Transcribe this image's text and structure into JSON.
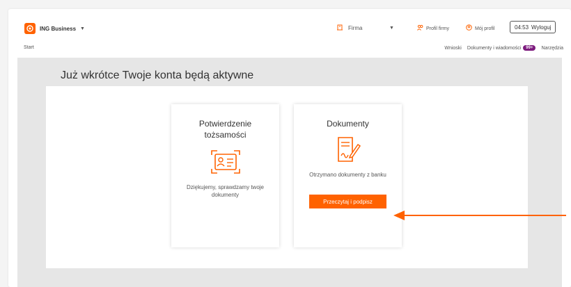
{
  "header": {
    "brand_name": "ING Business",
    "firm_label": "Firma",
    "profile_firm": "Profil firmy",
    "my_profile": "Mój profil",
    "session_time": "04:53",
    "logout": "Wyloguj"
  },
  "nav": {
    "start": "Start",
    "items": [
      {
        "label": "Wnioski"
      },
      {
        "label": "Dokumenty i wiadomości",
        "badge": "99+"
      },
      {
        "label": "Narzędzia"
      }
    ]
  },
  "main": {
    "title": "Już wkrótce Twoje konta będą aktywne",
    "cards": [
      {
        "title": "Potwierdzenie tożsamości",
        "text": "Dziękujemy, sprawdzamy twoje dokumenty",
        "icon": "id-card-icon"
      },
      {
        "title": "Dokumenty",
        "text": "Otrzymano dokumenty z banku",
        "icon": "document-sign-icon",
        "button": "Przeczytaj i podpisz"
      }
    ]
  },
  "colors": {
    "accent": "#ff6200",
    "badge": "#7d1b7e",
    "stage": "#e6e6e6"
  },
  "annotation": {
    "type": "arrow",
    "color": "#ff6200",
    "points_to": "Przeczytaj i podpisz"
  }
}
